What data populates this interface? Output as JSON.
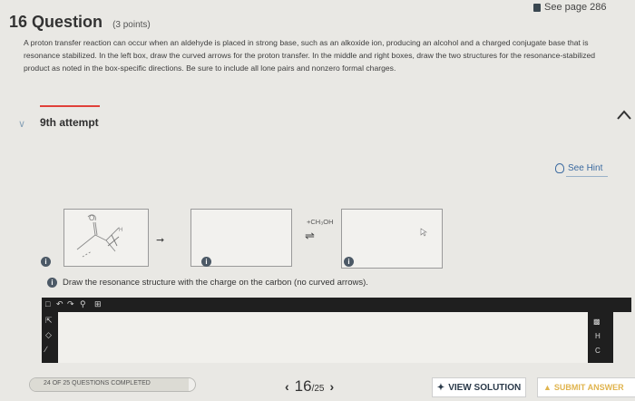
{
  "header": {
    "see_page": "See page 286",
    "question_number": "16",
    "question_word": "Question",
    "points": "(3 points)"
  },
  "prompt": "A proton transfer reaction can occur when an aldehyde is placed in strong base, such as an alkoxide ion, producing an alcohol and a charged conjugate base that is resonance stabilized. In the left box, draw the curved arrows for the proton transfer. In the middle and right boxes, draw the two structures for the resonance-stabilized product as noted in the box-specific directions. Be sure to include all lone pairs and nonzero formal charges.",
  "attempt": "9th attempt",
  "hint": "See Hint",
  "reaction": {
    "reagent": "+CH₃OH",
    "equilibrium_arrow": "⇌",
    "box_markers": [
      "i",
      "i",
      "i"
    ]
  },
  "instruction": "Draw the resonance structure with the charge on the carbon (no curved arrows).",
  "editor": {
    "right_tools": [
      "H",
      "C"
    ]
  },
  "footer": {
    "progress_text": "24 OF 25 QUESTIONS COMPLETED",
    "progress_fraction": 0.96,
    "current": "16",
    "total": "/25",
    "prev": "‹",
    "next": "›",
    "view_solution": "VIEW SOLUTION",
    "submit": "SUBMIT ANSWER"
  },
  "colors": {
    "accent_red": "#e0413a",
    "link_blue": "#3b6aa0",
    "submit_gold": "#e0b44e"
  }
}
